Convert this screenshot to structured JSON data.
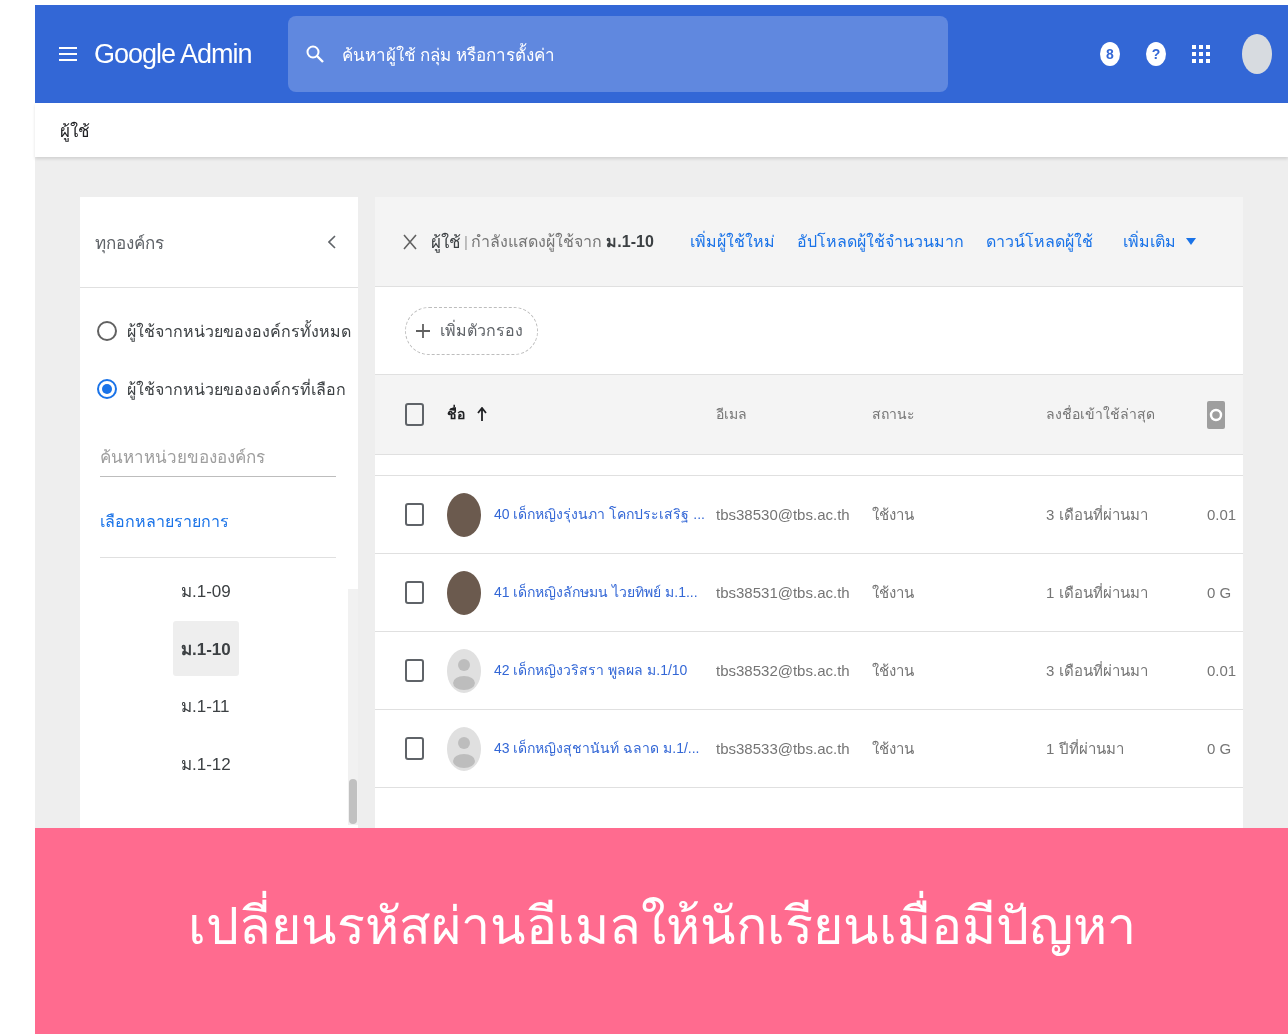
{
  "header": {
    "app_name": "Google Admin",
    "search_placeholder": "ค้นหาผู้ใช้ กลุ่ม หรือการตั้งค่า",
    "badge": "8",
    "help": "?"
  },
  "breadcrumb": "ผู้ใช้",
  "org_panel": {
    "title": "ทุกองค์กร",
    "scope_options": [
      {
        "label": "ผู้ใช้จากหน่วยขององค์กรทั้งหมด",
        "selected": false
      },
      {
        "label": "ผู้ใช้จากหน่วยขององค์กรที่เลือก",
        "selected": true
      }
    ],
    "search_placeholder": "ค้นหาหน่วยขององค์กร",
    "multi_select_link": "เลือกหลายรายการ",
    "tree": [
      {
        "label": "ม.1-09",
        "selected": false
      },
      {
        "label": "ม.1-10",
        "selected": true
      },
      {
        "label": "ม.1-11",
        "selected": false
      },
      {
        "label": "ม.1-12",
        "selected": false
      }
    ]
  },
  "users_panel": {
    "title": "ผู้ใช้",
    "separator": "|",
    "subtitle": "กำลังแสดงผู้ใช้จาก",
    "org": "ม.1-10",
    "actions": [
      "เพิ่มผู้ใช้ใหม่",
      "อัปโหลดผู้ใช้จำนวนมาก",
      "ดาวน์โหลดผู้ใช้"
    ],
    "more": "เพิ่มเติม",
    "add_filter": "เพิ่มตัวกรอง",
    "select_all": {
      "checked": false
    },
    "columns": [
      {
        "label": "ชื่อ",
        "sorted": true
      },
      {
        "label": "อีเมล",
        "sorted": false
      },
      {
        "label": "สถานะ",
        "sorted": false
      },
      {
        "label": "ลงชื่อเข้าใช้ล่าสุด",
        "sorted": false
      }
    ],
    "rows": [
      {
        "checked": false,
        "kind": "photo",
        "name": "40 เด็กหญิงรุ่งนภา โคกประเสริฐ ...",
        "email": "tbs38530@tbs.ac.th",
        "status": "ใช้งาน",
        "last_login": "3 เดือนที่ผ่านมา",
        "column_6": "0.01"
      },
      {
        "checked": false,
        "kind": "photo",
        "name": "41 เด็กหญิงลักษมน ไวยทิพย์ ม.1...",
        "email": "tbs38531@tbs.ac.th",
        "status": "ใช้งาน",
        "last_login": "1 เดือนที่ผ่านมา",
        "column_6": "0 G"
      },
      {
        "checked": false,
        "kind": "default",
        "name": "42 เด็กหญิงวริสรา พูลผล ม.1/10",
        "email": "tbs38532@tbs.ac.th",
        "status": "ใช้งาน",
        "last_login": "3 เดือนที่ผ่านมา",
        "column_6": "0.01"
      },
      {
        "checked": false,
        "kind": "default",
        "name": "43 เด็กหญิงสุชานันท์ ฉลาด ม.1/...",
        "email": "tbs38533@tbs.ac.th",
        "status": "ใช้งาน",
        "last_login": "1 ปีที่ผ่านมา",
        "column_6": "0 G"
      }
    ]
  },
  "banner": "เปลี่ยนรหัสผ่านอีเมลให้นักเรียนเมื่อมีปัญหา"
}
